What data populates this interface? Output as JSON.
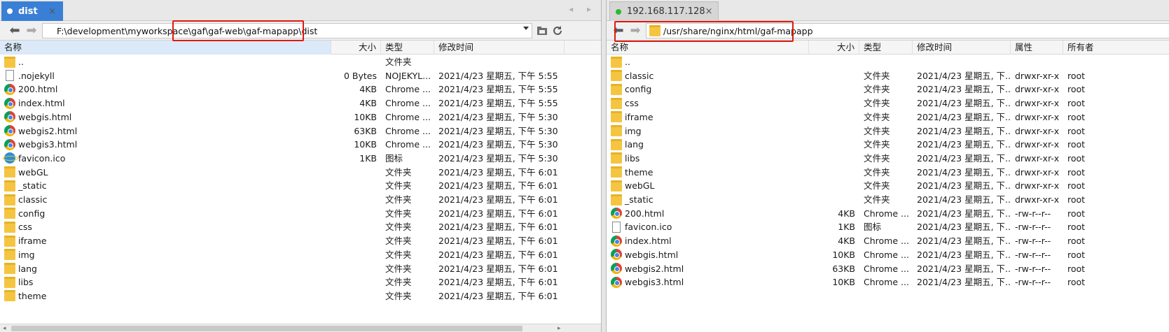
{
  "left": {
    "tab": {
      "label": "dist",
      "close": "×"
    },
    "tab_nav": "◂ ▸",
    "path": "F:\\development\\myworkspace\\gaf\\gaf-web\\gaf-mapapp\\dist",
    "columns": {
      "name": "名称",
      "size": "大小",
      "type": "类型",
      "modified": "修改时间"
    },
    "rows": [
      {
        "name": "..",
        "icon": "folder-icon",
        "size": "",
        "type": "文件夹",
        "modified": ""
      },
      {
        "name": ".nojekyll",
        "icon": "file-icon",
        "size": "0 Bytes",
        "type": "NOJEKYL...",
        "modified": "2021/4/23 星期五, 下午 5:55"
      },
      {
        "name": "200.html",
        "icon": "chrome-icon",
        "size": "4KB",
        "type": "Chrome ...",
        "modified": "2021/4/23 星期五, 下午 5:55"
      },
      {
        "name": "index.html",
        "icon": "chrome-icon",
        "size": "4KB",
        "type": "Chrome ...",
        "modified": "2021/4/23 星期五, 下午 5:55"
      },
      {
        "name": "webgis.html",
        "icon": "chrome-icon",
        "size": "10KB",
        "type": "Chrome ...",
        "modified": "2021/4/23 星期五, 下午 5:30"
      },
      {
        "name": "webgis2.html",
        "icon": "chrome-icon",
        "size": "63KB",
        "type": "Chrome ...",
        "modified": "2021/4/23 星期五, 下午 5:30"
      },
      {
        "name": "webgis3.html",
        "icon": "chrome-icon",
        "size": "10KB",
        "type": "Chrome ...",
        "modified": "2021/4/23 星期五, 下午 5:30"
      },
      {
        "name": "favicon.ico",
        "icon": "ie-icon",
        "size": "1KB",
        "type": "图标",
        "modified": "2021/4/23 星期五, 下午 5:30"
      },
      {
        "name": "webGL",
        "icon": "folder-icon",
        "size": "",
        "type": "文件夹",
        "modified": "2021/4/23 星期五, 下午 6:01"
      },
      {
        "name": "_static",
        "icon": "folder-icon",
        "size": "",
        "type": "文件夹",
        "modified": "2021/4/23 星期五, 下午 6:01"
      },
      {
        "name": "classic",
        "icon": "folder-icon",
        "size": "",
        "type": "文件夹",
        "modified": "2021/4/23 星期五, 下午 6:01"
      },
      {
        "name": "config",
        "icon": "folder-icon",
        "size": "",
        "type": "文件夹",
        "modified": "2021/4/23 星期五, 下午 6:01"
      },
      {
        "name": "css",
        "icon": "folder-icon",
        "size": "",
        "type": "文件夹",
        "modified": "2021/4/23 星期五, 下午 6:01"
      },
      {
        "name": "iframe",
        "icon": "folder-icon",
        "size": "",
        "type": "文件夹",
        "modified": "2021/4/23 星期五, 下午 6:01"
      },
      {
        "name": "img",
        "icon": "folder-icon",
        "size": "",
        "type": "文件夹",
        "modified": "2021/4/23 星期五, 下午 6:01"
      },
      {
        "name": "lang",
        "icon": "folder-icon",
        "size": "",
        "type": "文件夹",
        "modified": "2021/4/23 星期五, 下午 6:01"
      },
      {
        "name": "libs",
        "icon": "folder-icon",
        "size": "",
        "type": "文件夹",
        "modified": "2021/4/23 星期五, 下午 6:01"
      },
      {
        "name": "theme",
        "icon": "folder-icon",
        "size": "",
        "type": "文件夹",
        "modified": "2021/4/23 星期五, 下午 6:01"
      }
    ]
  },
  "right": {
    "tab": {
      "label": "192.168.117.128",
      "close": "×"
    },
    "path": "/usr/share/nginx/html/gaf-mapapp",
    "columns": {
      "name": "名称",
      "size": "大小",
      "type": "类型",
      "modified": "修改时间",
      "perms": "属性",
      "owner": "所有者"
    },
    "rows": [
      {
        "name": "..",
        "icon": "folder-icon",
        "size": "",
        "type": "",
        "modified": "",
        "perms": "",
        "owner": ""
      },
      {
        "name": "classic",
        "icon": "folder-icon",
        "size": "",
        "type": "文件夹",
        "modified": "2021/4/23 星期五, 下...",
        "perms": "drwxr-xr-x",
        "owner": "root"
      },
      {
        "name": "config",
        "icon": "folder-icon",
        "size": "",
        "type": "文件夹",
        "modified": "2021/4/23 星期五, 下...",
        "perms": "drwxr-xr-x",
        "owner": "root"
      },
      {
        "name": "css",
        "icon": "folder-icon",
        "size": "",
        "type": "文件夹",
        "modified": "2021/4/23 星期五, 下...",
        "perms": "drwxr-xr-x",
        "owner": "root"
      },
      {
        "name": "iframe",
        "icon": "folder-icon",
        "size": "",
        "type": "文件夹",
        "modified": "2021/4/23 星期五, 下...",
        "perms": "drwxr-xr-x",
        "owner": "root"
      },
      {
        "name": "img",
        "icon": "folder-icon",
        "size": "",
        "type": "文件夹",
        "modified": "2021/4/23 星期五, 下...",
        "perms": "drwxr-xr-x",
        "owner": "root"
      },
      {
        "name": "lang",
        "icon": "folder-icon",
        "size": "",
        "type": "文件夹",
        "modified": "2021/4/23 星期五, 下...",
        "perms": "drwxr-xr-x",
        "owner": "root"
      },
      {
        "name": "libs",
        "icon": "folder-icon",
        "size": "",
        "type": "文件夹",
        "modified": "2021/4/23 星期五, 下...",
        "perms": "drwxr-xr-x",
        "owner": "root"
      },
      {
        "name": "theme",
        "icon": "folder-icon",
        "size": "",
        "type": "文件夹",
        "modified": "2021/4/23 星期五, 下...",
        "perms": "drwxr-xr-x",
        "owner": "root"
      },
      {
        "name": "webGL",
        "icon": "folder-icon",
        "size": "",
        "type": "文件夹",
        "modified": "2021/4/23 星期五, 下...",
        "perms": "drwxr-xr-x",
        "owner": "root"
      },
      {
        "name": "_static",
        "icon": "folder-icon",
        "size": "",
        "type": "文件夹",
        "modified": "2021/4/23 星期五, 下...",
        "perms": "drwxr-xr-x",
        "owner": "root"
      },
      {
        "name": "200.html",
        "icon": "chrome-icon",
        "size": "4KB",
        "type": "Chrome ...",
        "modified": "2021/4/23 星期五, 下...",
        "perms": "-rw-r--r--",
        "owner": "root"
      },
      {
        "name": "favicon.ico",
        "icon": "file-icon",
        "size": "1KB",
        "type": "图标",
        "modified": "2021/4/23 星期五, 下...",
        "perms": "-rw-r--r--",
        "owner": "root"
      },
      {
        "name": "index.html",
        "icon": "chrome-icon",
        "size": "4KB",
        "type": "Chrome ...",
        "modified": "2021/4/23 星期五, 下...",
        "perms": "-rw-r--r--",
        "owner": "root"
      },
      {
        "name": "webgis.html",
        "icon": "chrome-icon",
        "size": "10KB",
        "type": "Chrome ...",
        "modified": "2021/4/23 星期五, 下...",
        "perms": "-rw-r--r--",
        "owner": "root"
      },
      {
        "name": "webgis2.html",
        "icon": "chrome-icon",
        "size": "63KB",
        "type": "Chrome ...",
        "modified": "2021/4/23 星期五, 下...",
        "perms": "-rw-r--r--",
        "owner": "root"
      },
      {
        "name": "webgis3.html",
        "icon": "chrome-icon",
        "size": "10KB",
        "type": "Chrome ...",
        "modified": "2021/4/23 星期五, 下...",
        "perms": "-rw-r--r--",
        "owner": "root"
      }
    ]
  },
  "colors": {
    "active_tab": "#3a7fd6",
    "highlight": "#e3170d",
    "online_dot": "#2eb82e"
  }
}
